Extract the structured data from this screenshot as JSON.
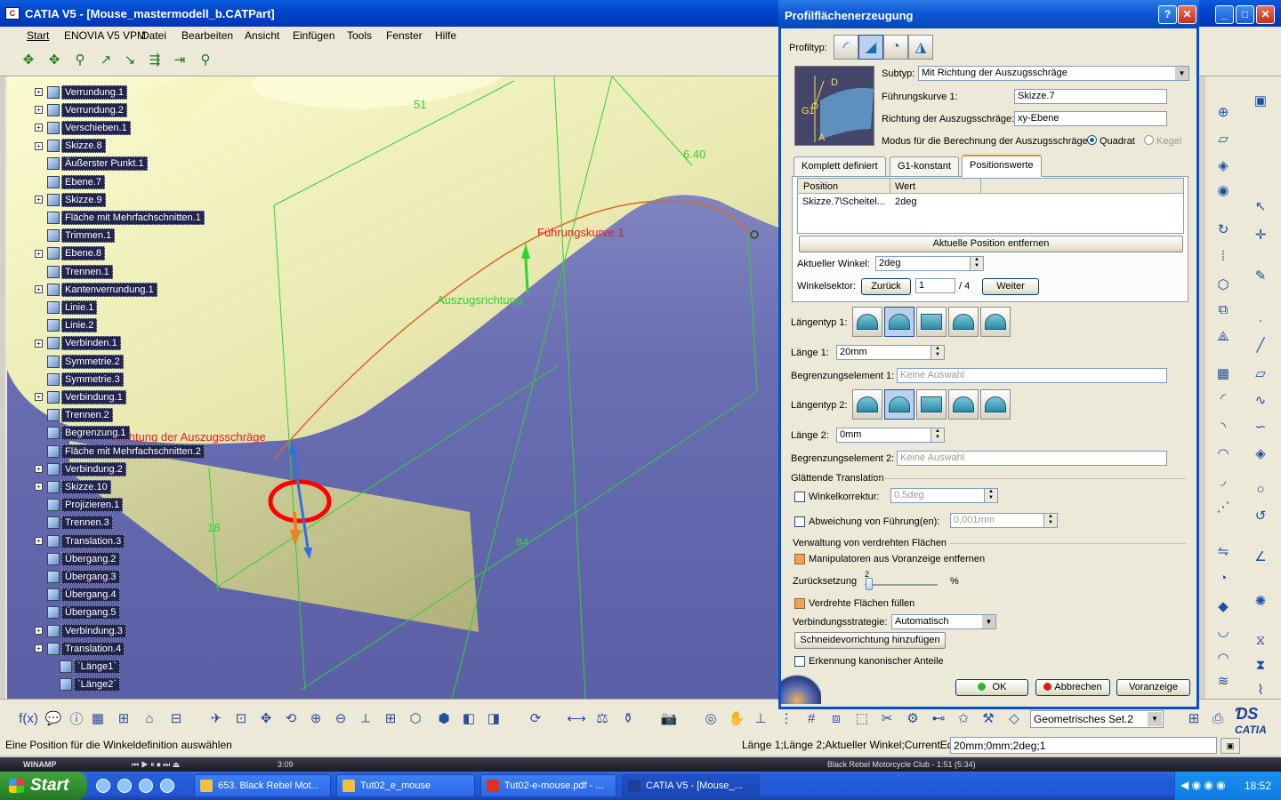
{
  "window": {
    "title": "CATIA V5 - [Mouse_mastermodell_b.CATPart]"
  },
  "menu": [
    "Start",
    "ENOVIA V5 VPM",
    "Datei",
    "Bearbeiten",
    "Ansicht",
    "Einfügen",
    "Tools",
    "Fenster",
    "Hilfe"
  ],
  "tree": {
    "items": [
      {
        "label": "Verrundung.1",
        "expand": true
      },
      {
        "label": "Verrundung.2",
        "expand": true
      },
      {
        "label": "Verschieben.1",
        "expand": true
      },
      {
        "label": "Skizze.8",
        "expand": true
      },
      {
        "label": "Äußerster Punkt.1",
        "expand": false
      },
      {
        "label": "Ebene.7",
        "expand": false
      },
      {
        "label": "Skizze.9",
        "expand": true
      },
      {
        "label": "Fläche mit Mehrfachschnitten.1",
        "expand": false
      },
      {
        "label": "Trimmen.1",
        "expand": false
      },
      {
        "label": "Ebene.8",
        "expand": true
      },
      {
        "label": "Trennen.1",
        "expand": false
      },
      {
        "label": "Kantenverrundung.1",
        "expand": true
      },
      {
        "label": "Linie.1",
        "expand": false
      },
      {
        "label": "Linie.2",
        "expand": false
      },
      {
        "label": "Verbinden.1",
        "expand": true
      },
      {
        "label": "Symmetrie.2",
        "expand": false
      },
      {
        "label": "Symmetrie.3",
        "expand": false
      },
      {
        "label": "Verbindung.1",
        "expand": true
      },
      {
        "label": "Trennen.2",
        "expand": false
      },
      {
        "label": "Begrenzung.1",
        "expand": false
      },
      {
        "label": "Fläche mit Mehrfachschnitten.2",
        "expand": false
      },
      {
        "label": "Verbindung.2",
        "expand": true
      },
      {
        "label": "Skizze.10",
        "expand": true
      },
      {
        "label": "Projizieren.1",
        "expand": false
      },
      {
        "label": "Trennen.3",
        "expand": false
      },
      {
        "label": "Translation.3",
        "expand": true
      },
      {
        "label": "Übergang.2",
        "expand": false
      },
      {
        "label": "Übergang.3",
        "expand": false
      },
      {
        "label": "Übergang.4",
        "expand": false
      },
      {
        "label": "Übergang.5",
        "expand": false
      },
      {
        "label": "Verbindung.3",
        "expand": true
      },
      {
        "label": "Translation.4",
        "expand": true
      },
      {
        "label": "`Länge1`",
        "expand": false
      },
      {
        "label": "`Länge2`",
        "expand": false
      }
    ]
  },
  "viewport": {
    "labels": {
      "fuehrungskurve": "Führungskurve 1",
      "auszugsrichtung": "Auszugsrichtung",
      "richtung": "Richtung der Auszugsschräge",
      "dim51": "51",
      "dim640": "6.40",
      "dim18": "18",
      "dim84": "84"
    }
  },
  "dialog": {
    "title": "Profilflächenerzeugung",
    "profiltyp_label": "Profiltyp:",
    "subtyp_label": "Subtyp:",
    "subtyp_value": "Mit Richtung der Auszugsschräge",
    "fuehrungskurve_label": "Führungskurve 1:",
    "fuehrungskurve_value": "Skizze.7",
    "richtung_label": "Richtung der Auszugsschräge:",
    "richtung_value": "xy-Ebene",
    "modus_label": "Modus für die Berechnung der Auszugsschräge:",
    "modus_opt1": "Quadrat",
    "modus_opt2": "Kegel",
    "tabs": [
      "Komplett definiert",
      "G1-konstant",
      "Positionswerte"
    ],
    "table": {
      "headers": [
        "Position",
        "Wert"
      ],
      "rows": [
        [
          "Skizze.7\\Scheitel...",
          "2deg"
        ]
      ]
    },
    "remove_btn": "Aktuelle Position entfernen",
    "winkel_label": "Aktueller Winkel:",
    "winkel_value": "2deg",
    "sektor_label": "Winkelsektor:",
    "zurueck_btn": "Zurück",
    "sektor_value": "1",
    "sektor_total": "/ 4",
    "weiter_btn": "Weiter",
    "laengentyp1_label": "Längentyp 1:",
    "laenge1_label": "Länge 1:",
    "laenge1_value": "20mm",
    "begrenz1_label": "Begrenzungselement 1:",
    "begrenz1_value": "Keine Auswahl",
    "laengentyp2_label": "Längentyp 2:",
    "laenge2_label": "Länge 2:",
    "laenge2_value": "0mm",
    "begrenz2_label": "Begrenzungselement 2:",
    "begrenz2_value": "Keine Auswahl",
    "glaettende_label": "Glättende Translation",
    "winkelkorrektur_label": "Winkelkorrektur:",
    "winkelkorrektur_value": "0,5deg",
    "abweichung_label": "Abweichung von Führung(en):",
    "abweichung_value": "0,001mm",
    "verwaltung_label": "Verwaltung von verdrehten Flächen",
    "manipulatoren_label": "Manipulatoren aus Voranzeige entfernen",
    "zurueck_setz_label": "Zurücksetzung",
    "slider_value": "2",
    "slider_unit": "%",
    "slider_fraction": 0.04,
    "verdrehte_label": "Verdrehte Flächen füllen",
    "strategie_label": "Verbindungsstrategie:",
    "strategie_value": "Automatisch",
    "schneide_btn": "Schneidevorrichtung hinzufügen",
    "kanonisch_label": "Erkennung kanonischer Anteile",
    "ok_btn": "OK",
    "abbrechen_btn": "Abbrechen",
    "voranzeige_btn": "Voranzeige",
    "preview": {
      "g1": "G1",
      "d": "D",
      "a": "A"
    }
  },
  "bottom": {
    "set_value": "Geometrisches Set.2",
    "logo": "CATIA"
  },
  "status": {
    "left": "Eine Position für die Winkeldefinition auswählen",
    "right": "Länge 1;Länge 2;Aktueller Winkel;CurrentEditor",
    "cmd": "20mm;0mm;2deg;1"
  },
  "winamp": {
    "label": "WINAMP",
    "time": "3:09",
    "track": "Black Rebel Motorcycle Club - 1:51 (5:34)"
  },
  "taskbar": {
    "start": "Start",
    "tasks": [
      "653. Black Rebel Mot...",
      "Tut02_e_mouse",
      "Tut02-e-mouse.pdf - ...",
      "CATIA V5 - [Mouse_..."
    ],
    "clock": "18:52"
  },
  "colors": {
    "accent": "#0a57d4",
    "tree_bg": "#22244e",
    "surface": "#e9e9b2",
    "annotation_green": "#2fd32f",
    "annotation_red": "#e02020"
  }
}
